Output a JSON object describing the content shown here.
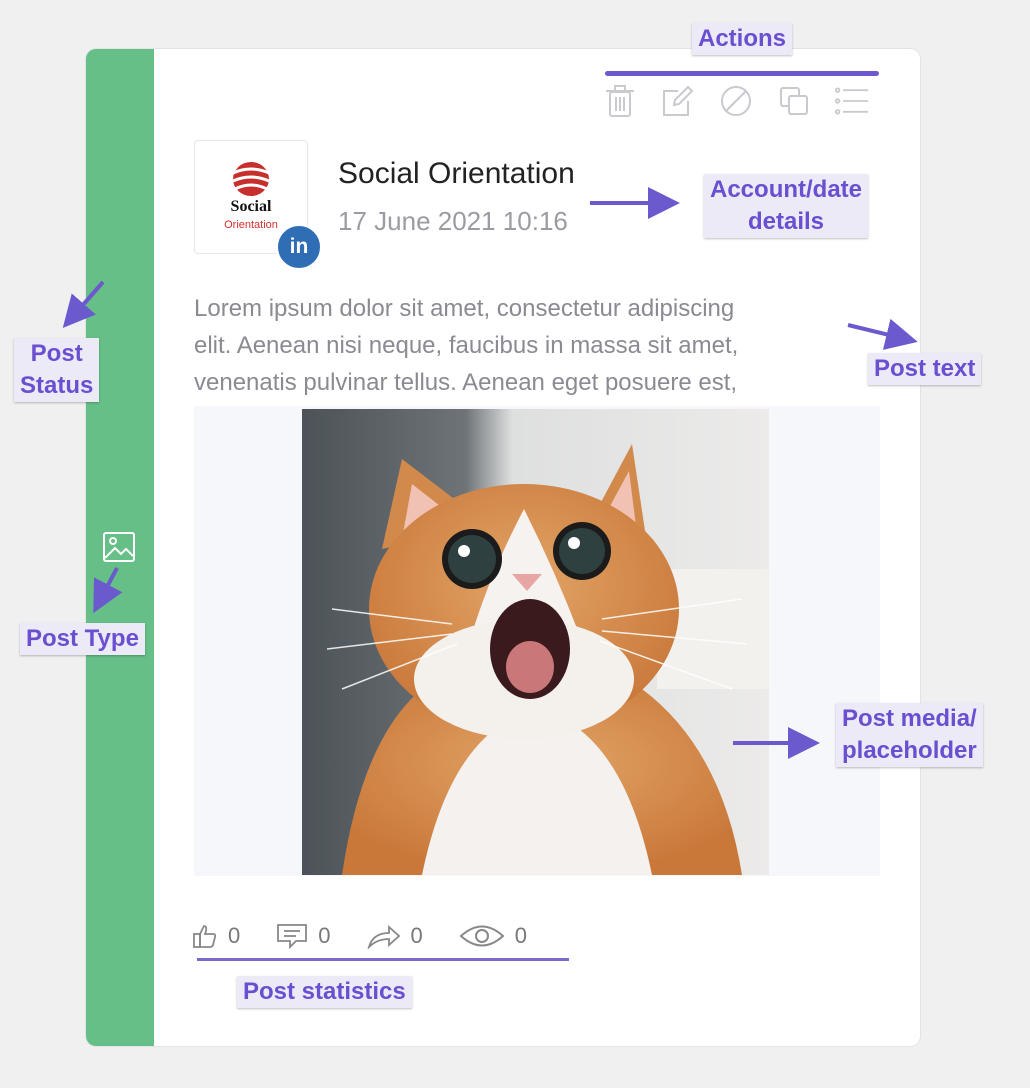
{
  "annotations": {
    "actions": "Actions",
    "account_date_line1": "Account/date",
    "account_date_line2": "details",
    "post_status_line1": "Post",
    "post_status_line2": "Status",
    "post_text": "Post text",
    "post_type": "Post Type",
    "post_media_line1": "Post media/",
    "post_media_line2": "placeholder",
    "post_statistics": "Post statistics"
  },
  "post": {
    "status_color": "#66bf86",
    "type_icon": "image-icon",
    "account_name": "Social Orientation",
    "date": "17 June 2021 10:16",
    "network": "linkedin",
    "network_badge": "in",
    "avatar_logo_line1": "Social",
    "avatar_logo_line2": "Orientation",
    "text": "Lorem ipsum dolor sit amet, consectetur adipiscing\nelit. Aenean nisi neque, faucibus in massa sit amet,\nvenenatis pulvinar tellus. Aenean eget posuere est,",
    "media": "cat-photo"
  },
  "actions": [
    "trash-icon",
    "edit-icon",
    "block-icon",
    "copy-icon",
    "list-icon"
  ],
  "stats": {
    "likes": "0",
    "comments": "0",
    "shares": "0",
    "views": "0"
  },
  "colors": {
    "accent": "#6a5acd",
    "status_green": "#66bf86",
    "linkedin": "#2f6eb5"
  }
}
